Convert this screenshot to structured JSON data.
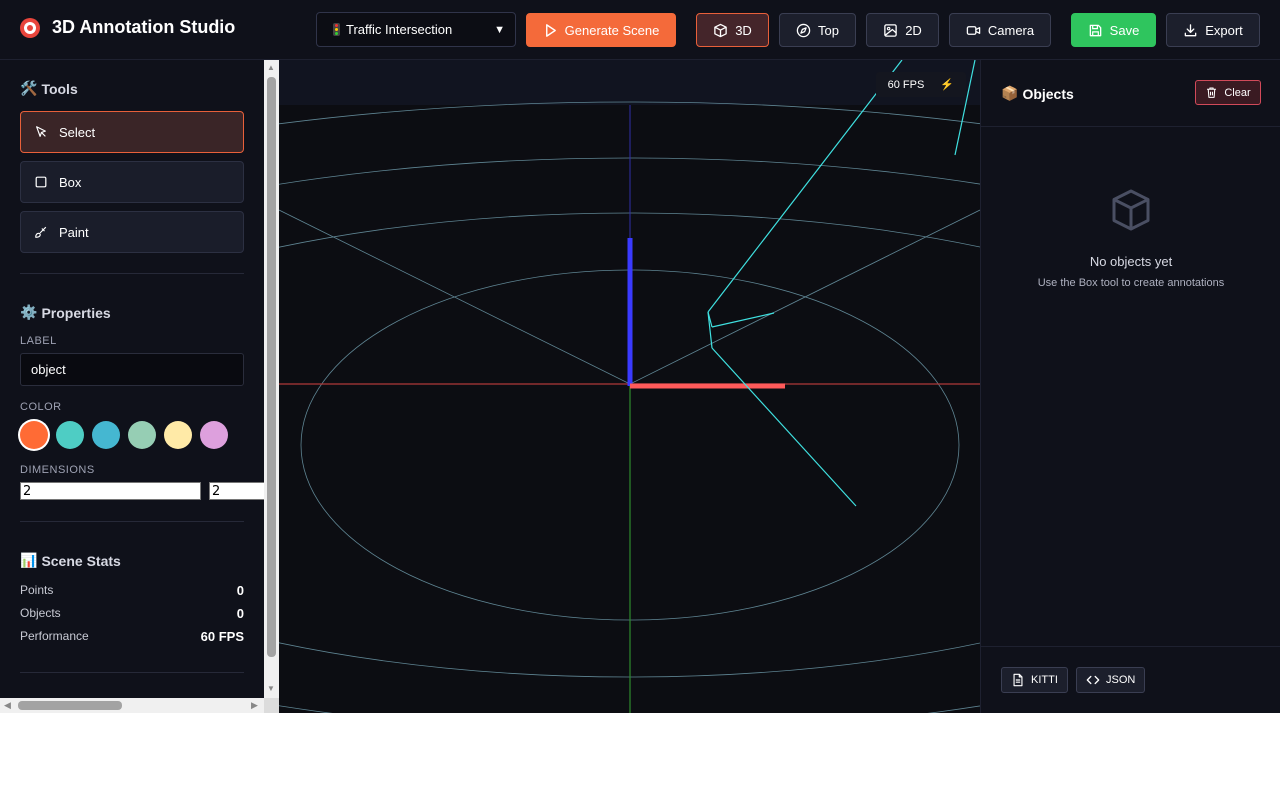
{
  "app": {
    "title": "3D Annotation Studio"
  },
  "header": {
    "scene_select": {
      "value": "Traffic Intersection"
    },
    "generate_label": "Generate Scene",
    "views": [
      {
        "label": "3D",
        "icon": "cube-icon",
        "active": true
      },
      {
        "label": "Top",
        "icon": "compass-icon",
        "active": false
      },
      {
        "label": "2D",
        "icon": "image-icon",
        "active": false
      },
      {
        "label": "Camera",
        "icon": "video-camera-icon",
        "active": false
      }
    ],
    "save_label": "Save",
    "export_label": "Export"
  },
  "sidebar": {
    "tools_title": "Tools",
    "tools": [
      {
        "label": "Select",
        "icon": "pointer-icon",
        "active": true
      },
      {
        "label": "Box",
        "icon": "square-icon",
        "active": false
      },
      {
        "label": "Paint",
        "icon": "brush-icon",
        "active": false
      }
    ],
    "properties_title": "Properties",
    "label_caption": "LABEL",
    "label_value": "object",
    "color_caption": "COLOR",
    "colors": [
      "#ff6b35",
      "#4ecdc4",
      "#45b7d1",
      "#96ceb4",
      "#ffeaa7",
      "#dda0dd"
    ],
    "selected_color": "#ff6b35",
    "dimensions_caption": "DIMENSIONS",
    "dimensions": [
      "2",
      "2"
    ],
    "stats_title": "Scene Stats",
    "stats": [
      {
        "label": "Points",
        "value": "0"
      },
      {
        "label": "Objects",
        "value": "0"
      },
      {
        "label": "Performance",
        "value": "60 FPS"
      }
    ]
  },
  "viewport": {
    "fps": "60 FPS",
    "axis_colors": {
      "x": "#ff5555",
      "y": "#3333ff",
      "z": "#33aa33"
    }
  },
  "objects_panel": {
    "title": "Objects",
    "clear_label": "Clear",
    "empty_title": "No objects yet",
    "empty_subtitle": "Use the Box tool to create annotations",
    "export_formats": [
      "KITTI",
      "JSON"
    ]
  }
}
